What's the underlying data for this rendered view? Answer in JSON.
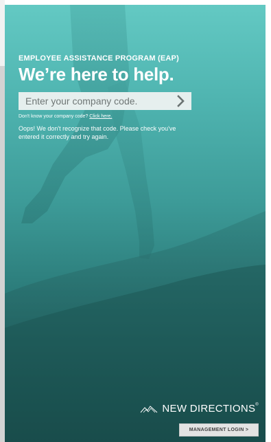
{
  "header": {
    "eyebrow": "EMPLOYEE ASSISTANCE PROGRAM (EAP)",
    "title": "We’re here to help."
  },
  "company_code": {
    "placeholder": "Enter your company code.",
    "value": "",
    "submit_icon": "chevron-right-icon"
  },
  "helper": {
    "text": "Don't know your company code?",
    "link_label": "Click here."
  },
  "error": {
    "message": "Oops! We don't recognize that code. Please check you've entered it correctly and try again."
  },
  "brand": {
    "name": "NEW DIRECTIONS",
    "mark": "®",
    "logo_icon": "mountain-logo-icon"
  },
  "footer": {
    "management_login_label": "MANAGEMENT LOGIN >"
  },
  "colors": {
    "panel_top": "#63c9c3",
    "panel_bottom": "#1a5655",
    "text": "#ffffff",
    "input_bg": "#e6efee",
    "button_bg": "#e3e3e3"
  }
}
